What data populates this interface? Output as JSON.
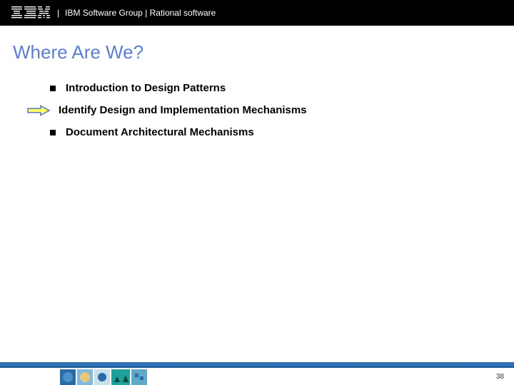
{
  "header": {
    "group_text": "IBM Software Group | Rational software"
  },
  "title": "Where Are We?",
  "agenda": {
    "items": [
      {
        "label": "Introduction to Design Patterns",
        "current": false
      },
      {
        "label": "Identify Design and Implementation Mechanisms",
        "current": true
      },
      {
        "label": "Document Architectural Mechanisms",
        "current": false
      }
    ]
  },
  "footer": {
    "page_number": "38"
  }
}
